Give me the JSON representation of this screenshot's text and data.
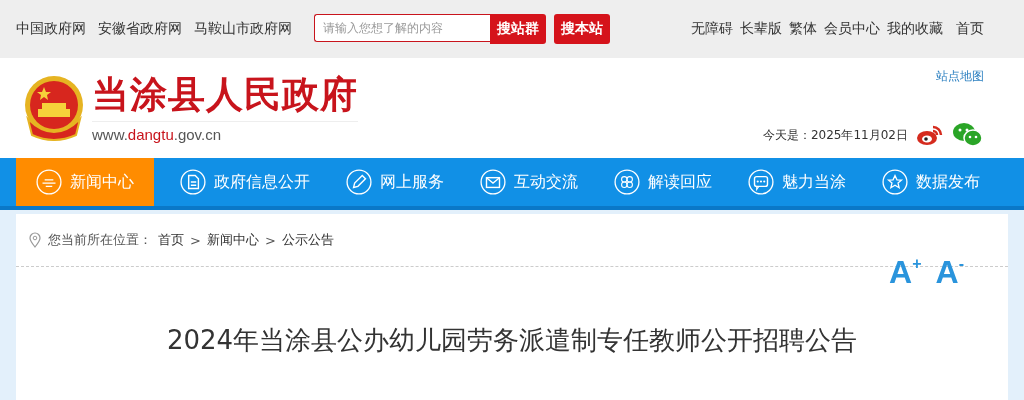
{
  "top_links": [
    "中国政府网",
    "安徽省政府网",
    "马鞍山市政府网"
  ],
  "search": {
    "placeholder": "请输入您想了解的内容",
    "buttons": [
      "搜站群",
      "搜本站"
    ]
  },
  "user_links": [
    "无障碍",
    "长辈版",
    "繁体",
    "会员中心",
    "我的收藏",
    "首页"
  ],
  "site": {
    "title": "当涂县人民政府",
    "url": {
      "prefix": "www.",
      "highlight": "dangtu",
      "suffix": ".gov.cn"
    },
    "sitemap": "站点地图",
    "date": "今天是：2025年11月02日"
  },
  "nav": [
    {
      "label": "新闻中心",
      "selected": true
    },
    {
      "label": "政府信息公开",
      "selected": false
    },
    {
      "label": "网上服务",
      "selected": false
    },
    {
      "label": "互动交流",
      "selected": false
    },
    {
      "label": "解读回应",
      "selected": false
    },
    {
      "label": "魅力当涂",
      "selected": false
    },
    {
      "label": "数据发布",
      "selected": false
    }
  ],
  "breadcrumb": {
    "label": "您当前所在位置：",
    "items": [
      "首页",
      "新闻中心",
      "公示公告"
    ],
    "separator": ">"
  },
  "font_buttons": [
    "A$^{+}$",
    "A$^{-}$"
  ],
  "article": {
    "title": "2024年当涂县公办幼儿园劳务派遣制专任教师公开招聘公告"
  }
}
